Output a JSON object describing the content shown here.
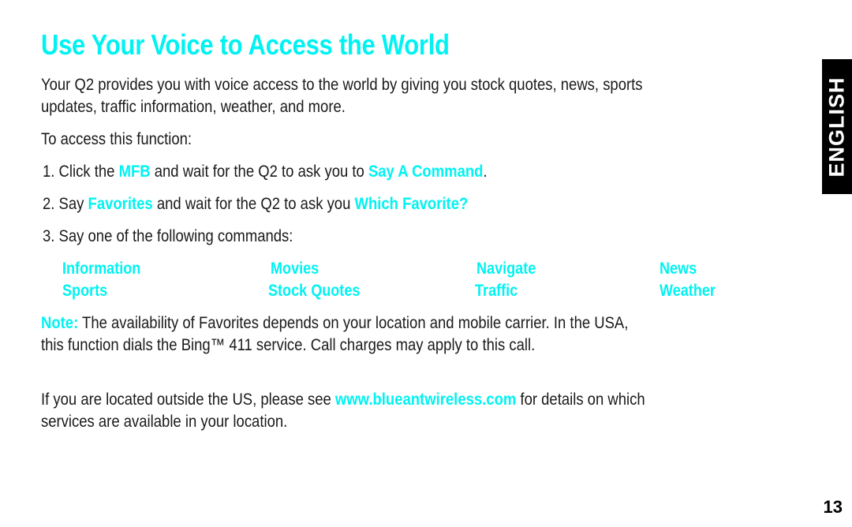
{
  "title": "Use Your Voice to Access the World",
  "intro": {
    "line1": "Your Q2 provides you with voice access to the world by giving you stock quotes, news, sports",
    "line2": "updates, traffic information, weather, and more."
  },
  "access_label": "To access this function:",
  "steps": [
    {
      "num": "1.",
      "pre": "Click the",
      "hl1": "MFB",
      "mid": "and wait for the Q2 to ask you to",
      "hl2": "Say A Command",
      "post": "."
    },
    {
      "num": "2.",
      "pre": "Say",
      "hl1": "Favorites",
      "mid": "and wait for the Q2 to ask you",
      "hl2": "Which Favorite?",
      "post": ""
    },
    {
      "num": "3.",
      "text": "Say one of the following commands:"
    }
  ],
  "commands": [
    [
      "Information",
      "Movies",
      "Navigate",
      "News"
    ],
    [
      "Sports",
      "Stock Quotes",
      "Traffic",
      "Weather"
    ]
  ],
  "note": {
    "label": "Note:",
    "line1": "The availability of Favorites depends on your location and mobile carrier. In the USA,",
    "line2": "this function dials the Bing™ 411 service. Call charges may apply to this call."
  },
  "outside": {
    "pre": "If you are located outside the US, please see",
    "link": "www.blueantwireless.com",
    "post": "for details on which",
    "line2": "services are available in your location."
  },
  "language_tab": "ENGLISH",
  "page_number": "13",
  "colors": {
    "accent": "#00F2F2",
    "text": "#1A1A1A",
    "tab_bg": "#000000"
  }
}
